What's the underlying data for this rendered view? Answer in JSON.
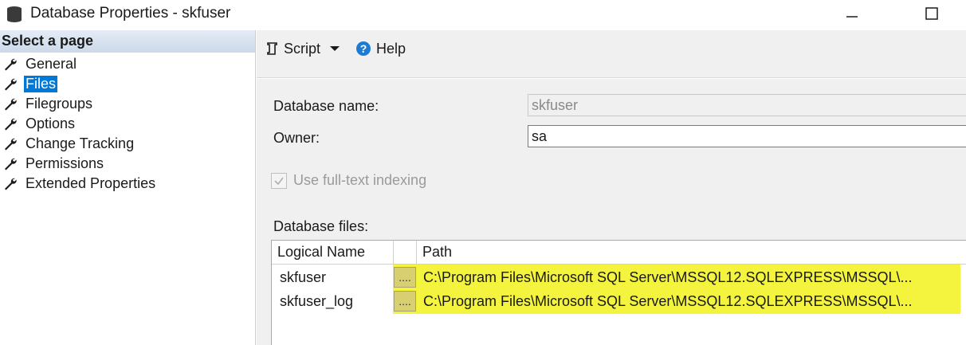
{
  "window": {
    "title": "Database Properties - skfuser",
    "icon": "database-icon"
  },
  "left_panel": {
    "header": "Select a page",
    "items": [
      {
        "label": "General",
        "icon": "wrench-icon",
        "selected": false
      },
      {
        "label": "Files",
        "icon": "wrench-icon",
        "selected": true
      },
      {
        "label": "Filegroups",
        "icon": "wrench-icon",
        "selected": false
      },
      {
        "label": "Options",
        "icon": "wrench-icon",
        "selected": false
      },
      {
        "label": "Change Tracking",
        "icon": "wrench-icon",
        "selected": false
      },
      {
        "label": "Permissions",
        "icon": "wrench-icon",
        "selected": false
      },
      {
        "label": "Extended Properties",
        "icon": "wrench-icon",
        "selected": false
      }
    ]
  },
  "toolbar": {
    "script_label": "Script",
    "help_label": "Help"
  },
  "form": {
    "database_name_label": "Database name:",
    "database_name_value": "skfuser",
    "owner_label": "Owner:",
    "owner_value": "sa",
    "fulltext_label": "Use full-text indexing",
    "fulltext_checked": true,
    "files_label": "Database files:"
  },
  "files_table": {
    "columns": [
      "Logical Name",
      "Path"
    ],
    "rows": [
      {
        "logical_name": "skfuser",
        "button": "....",
        "path": "C:\\Program Files\\Microsoft SQL Server\\MSSQL12.SQLEXPRESS\\MSSQL\\..."
      },
      {
        "logical_name": "skfuser_log",
        "button": "....",
        "path": "C:\\Program Files\\Microsoft SQL Server\\MSSQL12.SQLEXPRESS\\MSSQL\\..."
      }
    ]
  },
  "colors": {
    "selection": "#0078d7",
    "highlight": "#f4f43e",
    "header_gradient_top": "#e4ecf6",
    "header_gradient_bottom": "#cbd9ea",
    "help_icon": "#1c7cd5"
  }
}
